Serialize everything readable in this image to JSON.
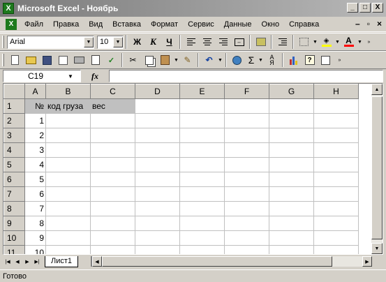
{
  "window": {
    "title": "Microsoft Excel - Ноябрь",
    "minimize": "_",
    "maximize": "□",
    "close": "X"
  },
  "menu": {
    "items": [
      "Файл",
      "Правка",
      "Вид",
      "Вставка",
      "Формат",
      "Сервис",
      "Данные",
      "Окно",
      "Справка"
    ],
    "doc_minimize": "–",
    "doc_restore": "▫",
    "doc_close": "×"
  },
  "format_toolbar": {
    "font_name": "Arial",
    "font_size": "10",
    "bold_label": "Ж",
    "italic_label": "К",
    "underline_label": "Ч",
    "font_color": "#ff0000",
    "fill_color": "#ffff00"
  },
  "standard_toolbar": {
    "sum_label": "Σ"
  },
  "formula_bar": {
    "name_box": "C19",
    "fx_label": "fx",
    "formula": ""
  },
  "grid": {
    "columns": [
      "A",
      "B",
      "C",
      "D",
      "E",
      "F",
      "G",
      "H"
    ],
    "rows": [
      {
        "n": "1",
        "cells": [
          "№",
          "код груза",
          "вес",
          "",
          "",
          "",
          "",
          ""
        ]
      },
      {
        "n": "2",
        "cells": [
          "1",
          "",
          "",
          "",
          "",
          "",
          "",
          ""
        ]
      },
      {
        "n": "3",
        "cells": [
          "2",
          "",
          "",
          "",
          "",
          "",
          "",
          ""
        ]
      },
      {
        "n": "4",
        "cells": [
          "3",
          "",
          "",
          "",
          "",
          "",
          "",
          ""
        ]
      },
      {
        "n": "5",
        "cells": [
          "4",
          "",
          "",
          "",
          "",
          "",
          "",
          ""
        ]
      },
      {
        "n": "6",
        "cells": [
          "5",
          "",
          "",
          "",
          "",
          "",
          "",
          ""
        ]
      },
      {
        "n": "7",
        "cells": [
          "6",
          "",
          "",
          "",
          "",
          "",
          "",
          ""
        ]
      },
      {
        "n": "8",
        "cells": [
          "7",
          "",
          "",
          "",
          "",
          "",
          "",
          ""
        ]
      },
      {
        "n": "9",
        "cells": [
          "8",
          "",
          "",
          "",
          "",
          "",
          "",
          ""
        ]
      },
      {
        "n": "10",
        "cells": [
          "9",
          "",
          "",
          "",
          "",
          "",
          "",
          ""
        ]
      },
      {
        "n": "11",
        "cells": [
          "10",
          "",
          "",
          "",
          "",
          "",
          "",
          ""
        ]
      }
    ]
  },
  "sheets": {
    "active": "Лист1"
  },
  "status": {
    "text": "Готово"
  }
}
